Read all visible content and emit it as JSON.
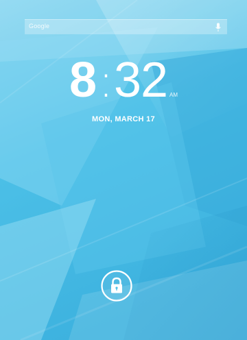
{
  "search": {
    "label": "Google",
    "mic_icon": "microphone-icon"
  },
  "clock": {
    "hour": "8",
    "separator": ":",
    "minutes": "32",
    "ampm": "AM"
  },
  "date": "MON, MARCH 17",
  "unlock": {
    "icon": "padlock-icon"
  },
  "colors": {
    "wallpaper_base": "#49bfe6",
    "wallpaper_light": "#8ad8f2",
    "wallpaper_dark": "#2f9fd0",
    "text": "#ffffff"
  }
}
